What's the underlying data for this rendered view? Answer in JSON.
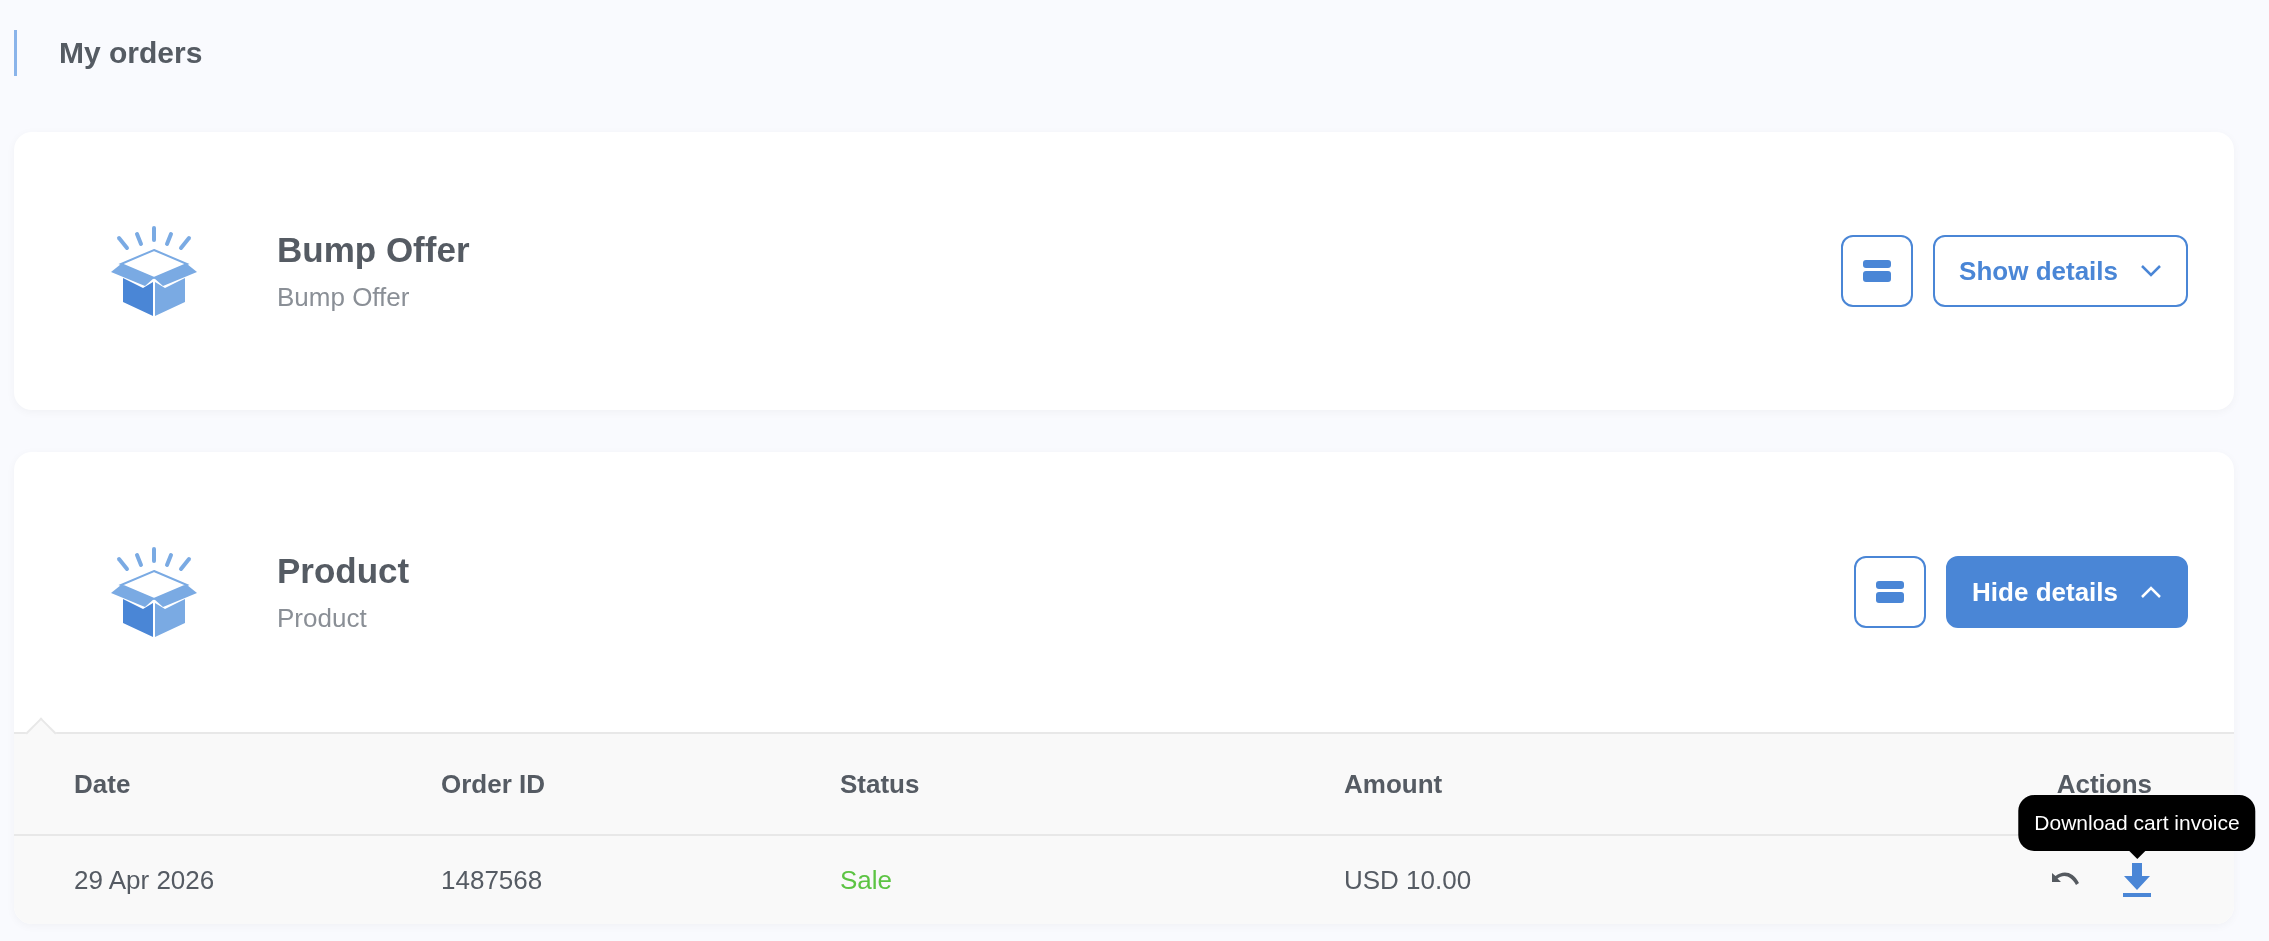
{
  "page": {
    "title": "My orders"
  },
  "orders": [
    {
      "name": "Bump Offer",
      "subtitle": "Bump Offer",
      "toggle_label": "Show details",
      "expanded": false
    },
    {
      "name": "Product",
      "subtitle": "Product",
      "toggle_label": "Hide details",
      "expanded": true,
      "details": {
        "columns": [
          "Date",
          "Order ID",
          "Status",
          "Amount",
          "Actions"
        ],
        "rows": [
          {
            "date": "29 Apr 2026",
            "order_id": "1487568",
            "status": "Sale",
            "color": "#5cc443",
            "amount": "USD 10.00",
            "tooltip": "Download cart invoice"
          }
        ]
      }
    }
  ]
}
